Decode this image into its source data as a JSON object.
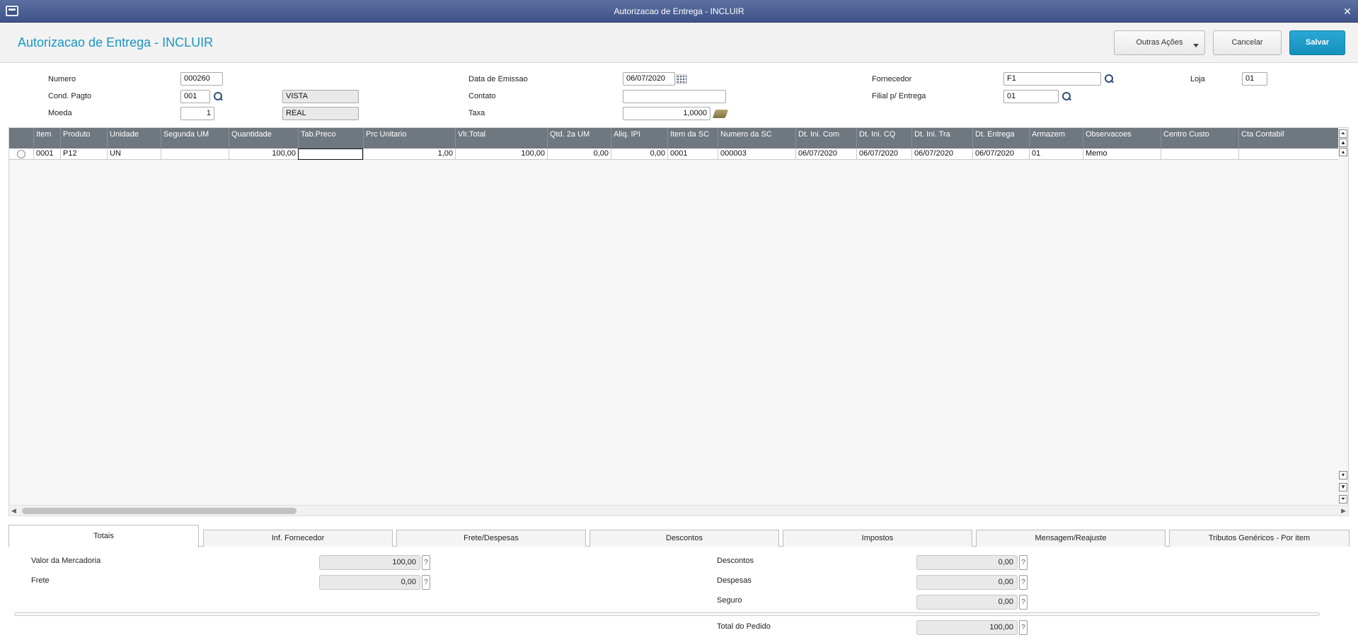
{
  "window": {
    "title": "Autorizacao de Entrega - INCLUIR"
  },
  "header": {
    "title": "Autorizacao de Entrega - INCLUIR",
    "buttons": {
      "more": "Outras Ações",
      "cancel": "Cancelar",
      "save": "Salvar"
    }
  },
  "form": {
    "numero": {
      "label": "Numero",
      "value": "000260"
    },
    "cond_pagto": {
      "label": "Cond. Pagto",
      "value": "001",
      "desc": "VISTA"
    },
    "moeda": {
      "label": "Moeda",
      "value": "1",
      "desc": "REAL"
    },
    "data_emissao": {
      "label": "Data de Emissao",
      "value": "06/07/2020"
    },
    "contato": {
      "label": "Contato",
      "value": ""
    },
    "taxa": {
      "label": "Taxa",
      "value": "1,0000"
    },
    "fornecedor": {
      "label": "Fornecedor",
      "value": "F1"
    },
    "loja": {
      "label": "Loja",
      "value": "01"
    },
    "filial_entrega": {
      "label": "Filial p/ Entrega",
      "value": "01"
    }
  },
  "grid": {
    "columns": [
      "Item",
      "Produto",
      "Unidade",
      "Segunda UM",
      "Quantidade",
      "Tab.Preco",
      "Prc Unitario",
      "Vlr.Total",
      "Qtd. 2a UM",
      "Aliq. IPI",
      "Item da SC",
      "Numero da SC",
      "Dt. Ini. Com",
      "Dt. Ini. CQ",
      "Dt. Ini. Tra",
      "Dt. Entrega",
      "Armazem",
      "Observacoes",
      "Centro Custo",
      "Cta Contabil"
    ],
    "rows": [
      [
        "0001",
        "P12",
        "UN",
        "",
        "100,00",
        "",
        "1,00",
        "100,00",
        "0,00",
        "0,00",
        "0001",
        "000003",
        "06/07/2020",
        "06/07/2020",
        "06/07/2020",
        "06/07/2020",
        "01",
        "Memo",
        "",
        ""
      ]
    ]
  },
  "tabs": [
    "Totais",
    "Inf. Fornecedor",
    "Frete/Despesas",
    "Descontos",
    "Impostos",
    "Mensagem/Reajuste",
    "Tributos Genéricos - Por item"
  ],
  "totals": {
    "valor_mercadoria": {
      "label": "Valor da Mercadoria",
      "value": "100,00"
    },
    "frete": {
      "label": "Frete",
      "value": "0,00"
    },
    "descontos": {
      "label": "Descontos",
      "value": "0,00"
    },
    "despesas": {
      "label": "Despesas",
      "value": "0,00"
    },
    "seguro": {
      "label": "Seguro",
      "value": "0,00"
    },
    "total_pedido": {
      "label": "Total do Pedido",
      "value": "100,00"
    },
    "help_glyph": "?"
  }
}
